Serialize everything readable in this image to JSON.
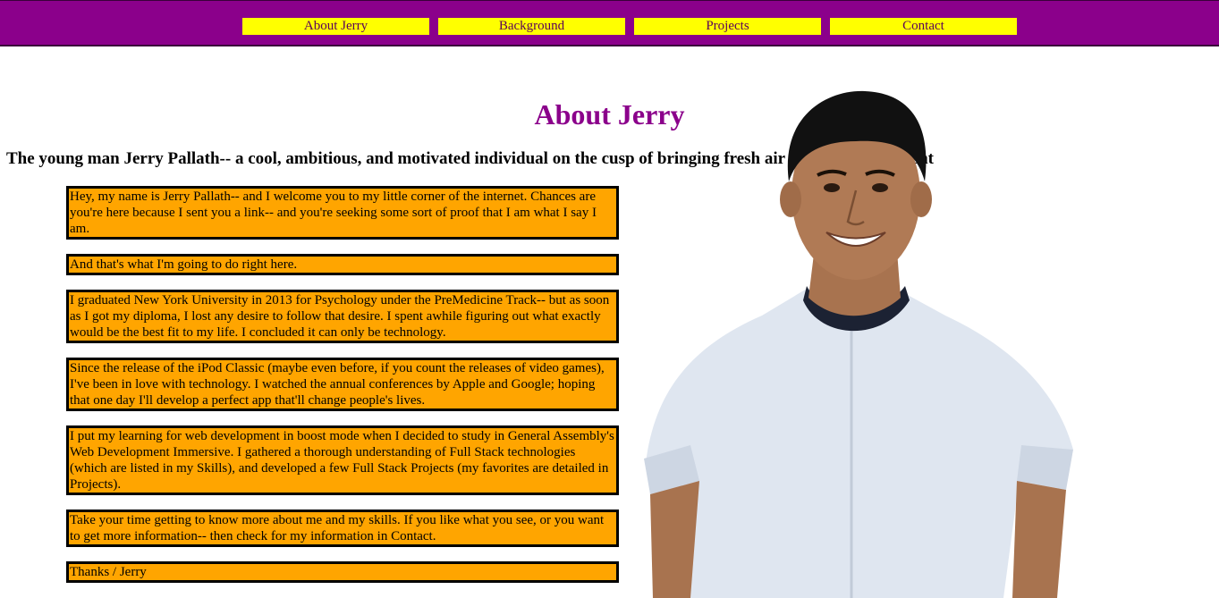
{
  "nav": {
    "items": [
      {
        "label": "About Jerry"
      },
      {
        "label": "Background"
      },
      {
        "label": "Projects"
      },
      {
        "label": "Contact"
      }
    ]
  },
  "page": {
    "title": "About Jerry",
    "subtitle": "The young man Jerry Pallath-- a cool, ambitious, and motivated individual on the cusp of bringing fresh air to web development",
    "paragraphs": [
      "Hey, my name is Jerry Pallath-- and I welcome you to my little corner of the internet. Chances are you're here because I sent you a link-- and you're seeking some sort of proof that I am what I say I am.",
      "And that's what I'm going to do right here.",
      "I graduated New York University in 2013 for Psychology under the PreMedicine Track-- but as soon as I got my diploma, I lost any desire to follow that desire. I spent awhile figuring out what exactly would be the best fit to my life. I concluded it can only be technology.",
      "Since the release of the iPod Classic (maybe even before, if you count the releases of video games), I've been in love with technology. I watched the annual conferences by Apple and Google; hoping that one day I'll develop a perfect app that'll change people's lives.",
      "I put my learning for web development in boost mode when I decided to study in General Assembly's Web Development Immersive. I gathered a thorough understanding of Full Stack technologies (which are listed in my Skills), and developed a few Full Stack Projects (my favorites are detailed in Projects).",
      "Take your time getting to know more about me and my skills. If you like what you see, or you want to get more information-- then check for my information in Contact.",
      "Thanks / Jerry"
    ]
  },
  "colors": {
    "nav_background": "#8b008b",
    "nav_button": "#ffff00",
    "title": "#8b008b",
    "paragraph_background": "#ffa500"
  }
}
